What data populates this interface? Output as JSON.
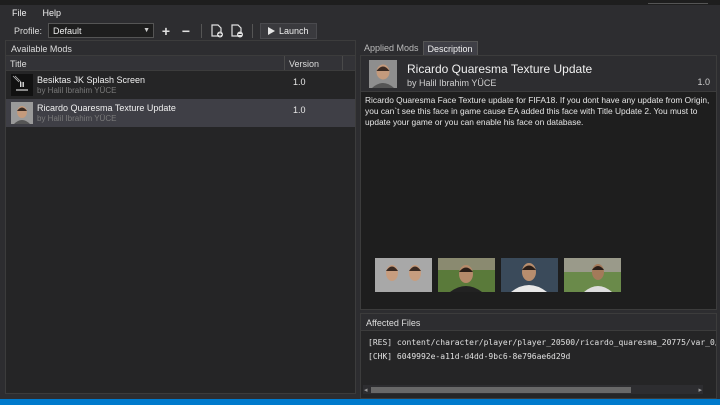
{
  "menu": {
    "file": "File",
    "help": "Help"
  },
  "toolbar": {
    "profile_label": "Profile:",
    "profile_value": "Default",
    "add_icon": "+",
    "remove_icon": "−",
    "launch_label": "Launch"
  },
  "left": {
    "header": "Available Mods",
    "columns": {
      "title": "Title",
      "version": "Version"
    },
    "mods": [
      {
        "title": "Besiktas JK Splash Screen",
        "author": "by Halil Ibrahim YÜCE",
        "version": "1.0"
      },
      {
        "title": "Ricardo Quaresma Texture Update",
        "author": "by Halil Ibrahim YÜCE",
        "version": "1.0"
      }
    ]
  },
  "tabs": {
    "applied": "Applied Mods",
    "description": "Description"
  },
  "description": {
    "title": "Ricardo Quaresma Texture Update",
    "author": "by Halil Ibrahim YÜCE",
    "version": "1.0",
    "text": "Ricardo Quaresma Face Texture update for FIFA18. If you dont have any update from Origin, you can`t see this face in game cause EA added this face with Title Update 2. You must to update your game or you can enable his face on database."
  },
  "affected": {
    "header": "Affected Files",
    "lines": [
      "[RES] content/character/player/player_20500/ricardo_quaresma_20775/var_0/",
      "[CHK] 6049992e-a11d-d4dd-9bc6-8e796ae6d29d"
    ]
  },
  "colors": {
    "accent": "#007acc",
    "background": "#2d2d30",
    "selected_row": "#3f3f46"
  }
}
